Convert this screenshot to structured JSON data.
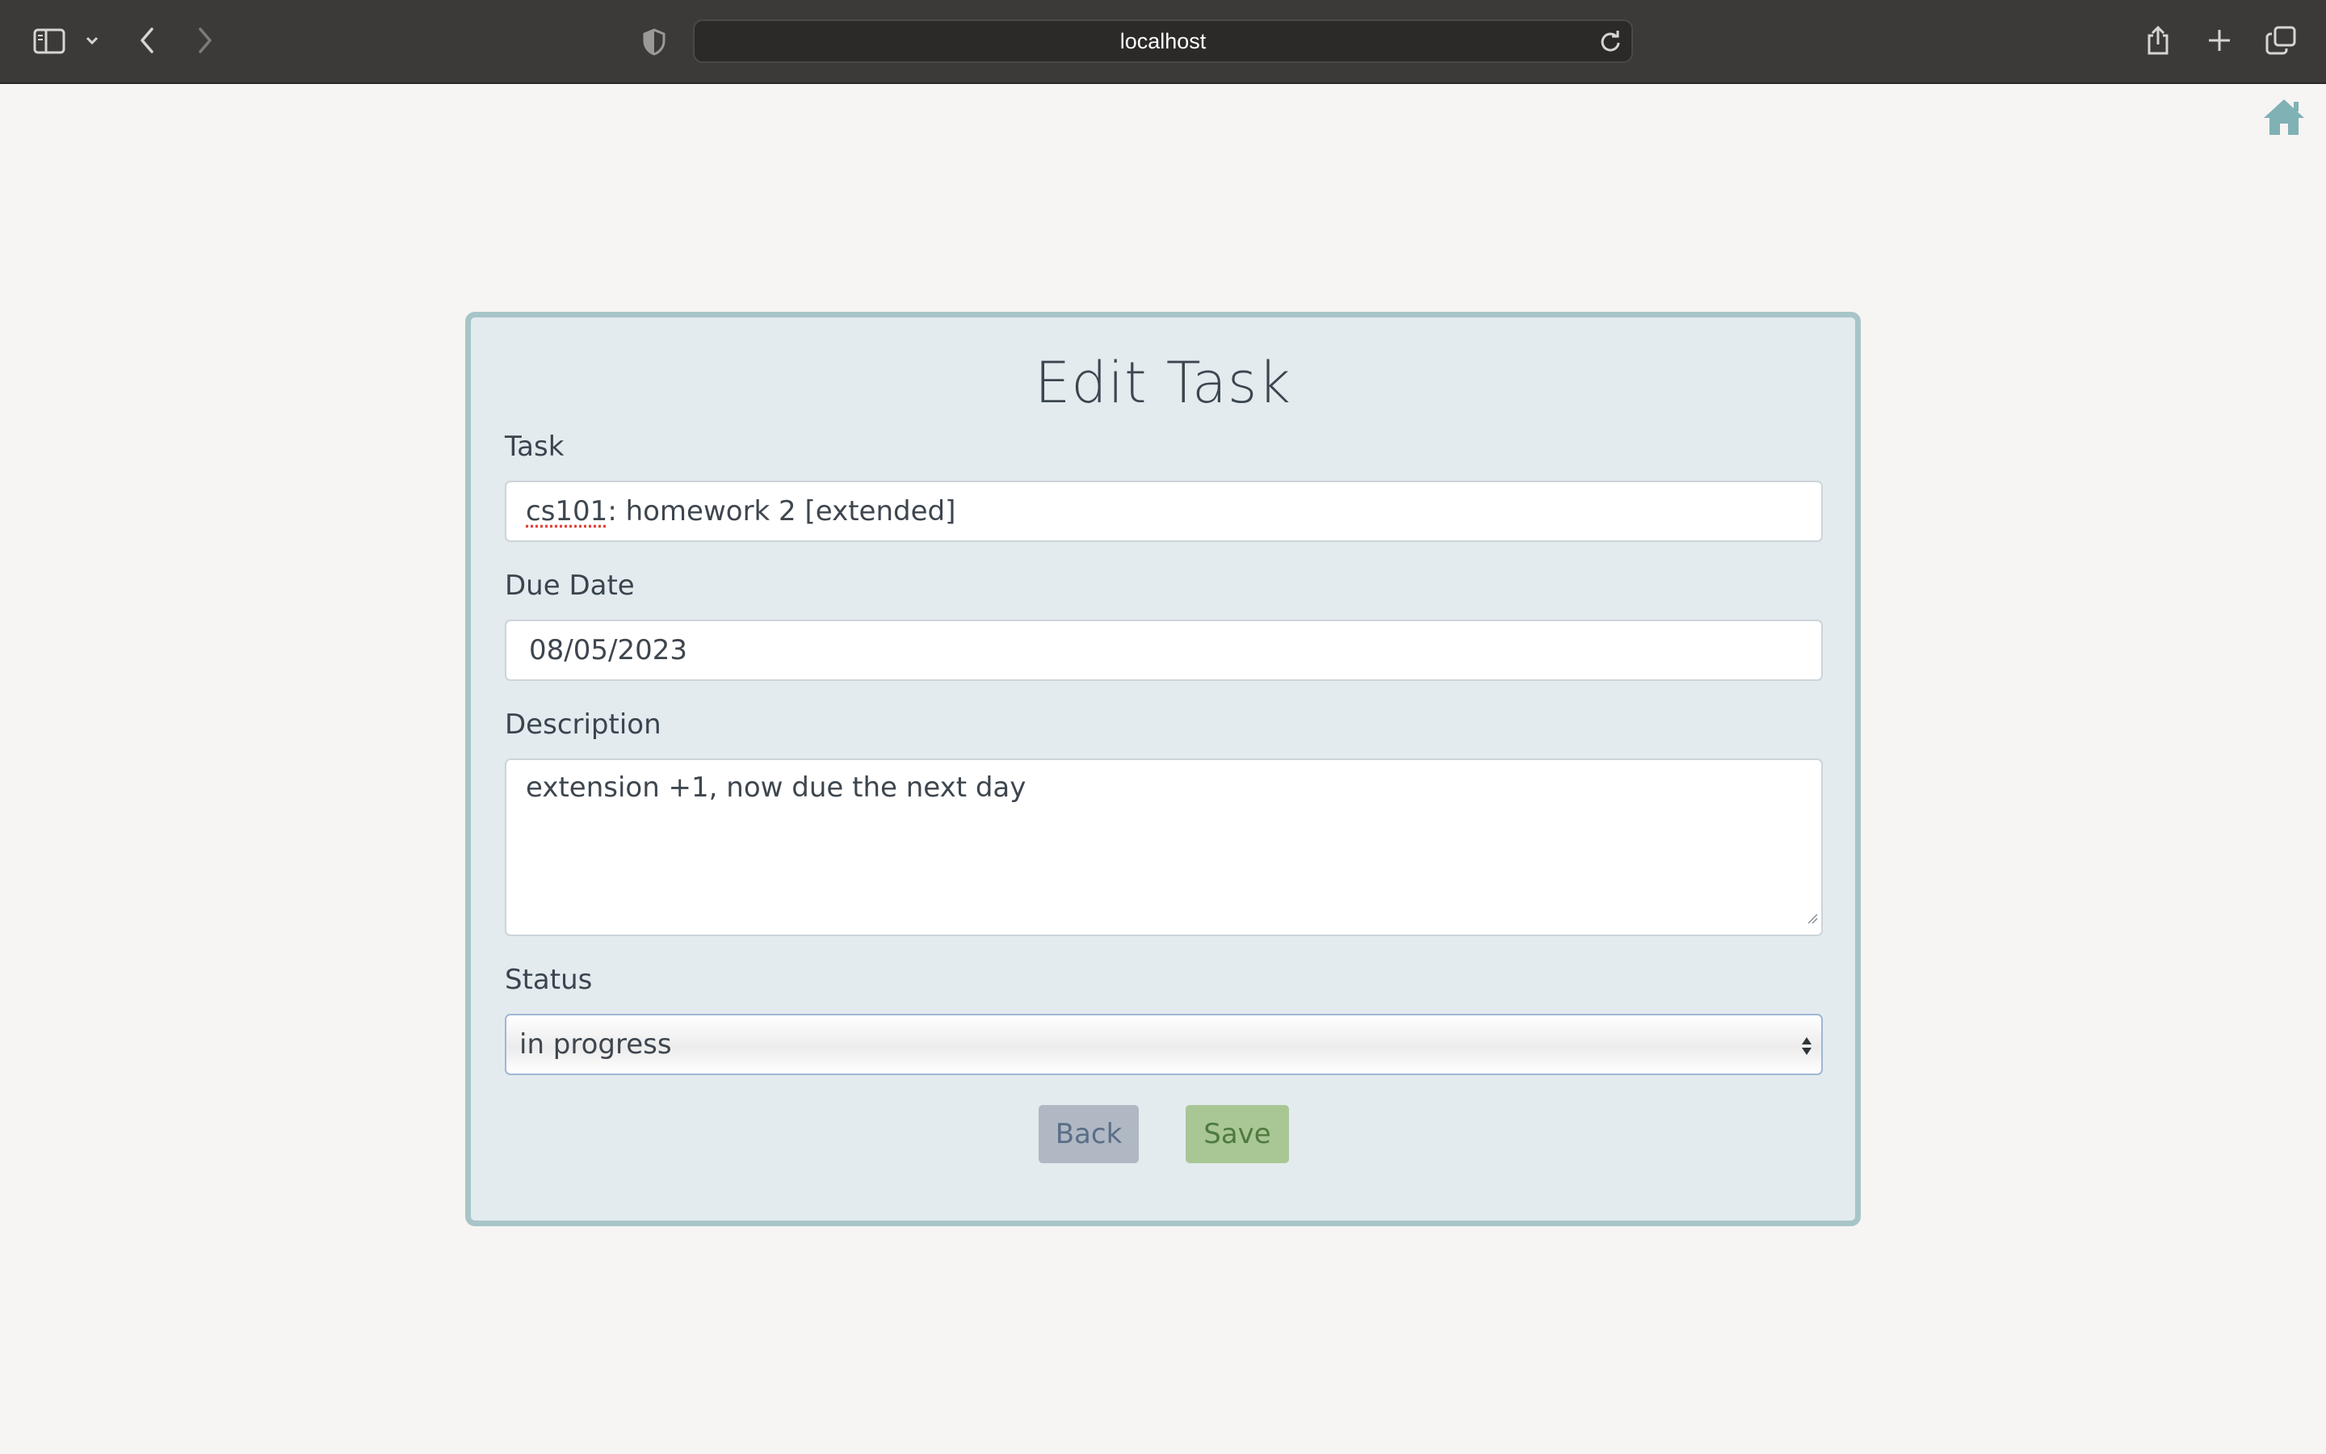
{
  "browser": {
    "address": "localhost"
  },
  "form": {
    "title": "Edit Task",
    "task": {
      "label": "Task",
      "value_prefix": "cs101",
      "value_rest": ": homework 2 [extended]"
    },
    "due_date": {
      "label": "Due Date",
      "value": "08/05/2023"
    },
    "description": {
      "label": "Description",
      "value": "extension +1, now due the next day"
    },
    "status": {
      "label": "Status",
      "value": "in progress"
    },
    "buttons": {
      "back": "Back",
      "save": "Save"
    }
  },
  "colors": {
    "toolbar": "#3b3a38",
    "card_bg": "#e3ebee",
    "card_border": "#a7c5c8",
    "home_icon": "#7fb1b5",
    "back_button": "#b0b8c4",
    "save_button": "#a9c795"
  }
}
